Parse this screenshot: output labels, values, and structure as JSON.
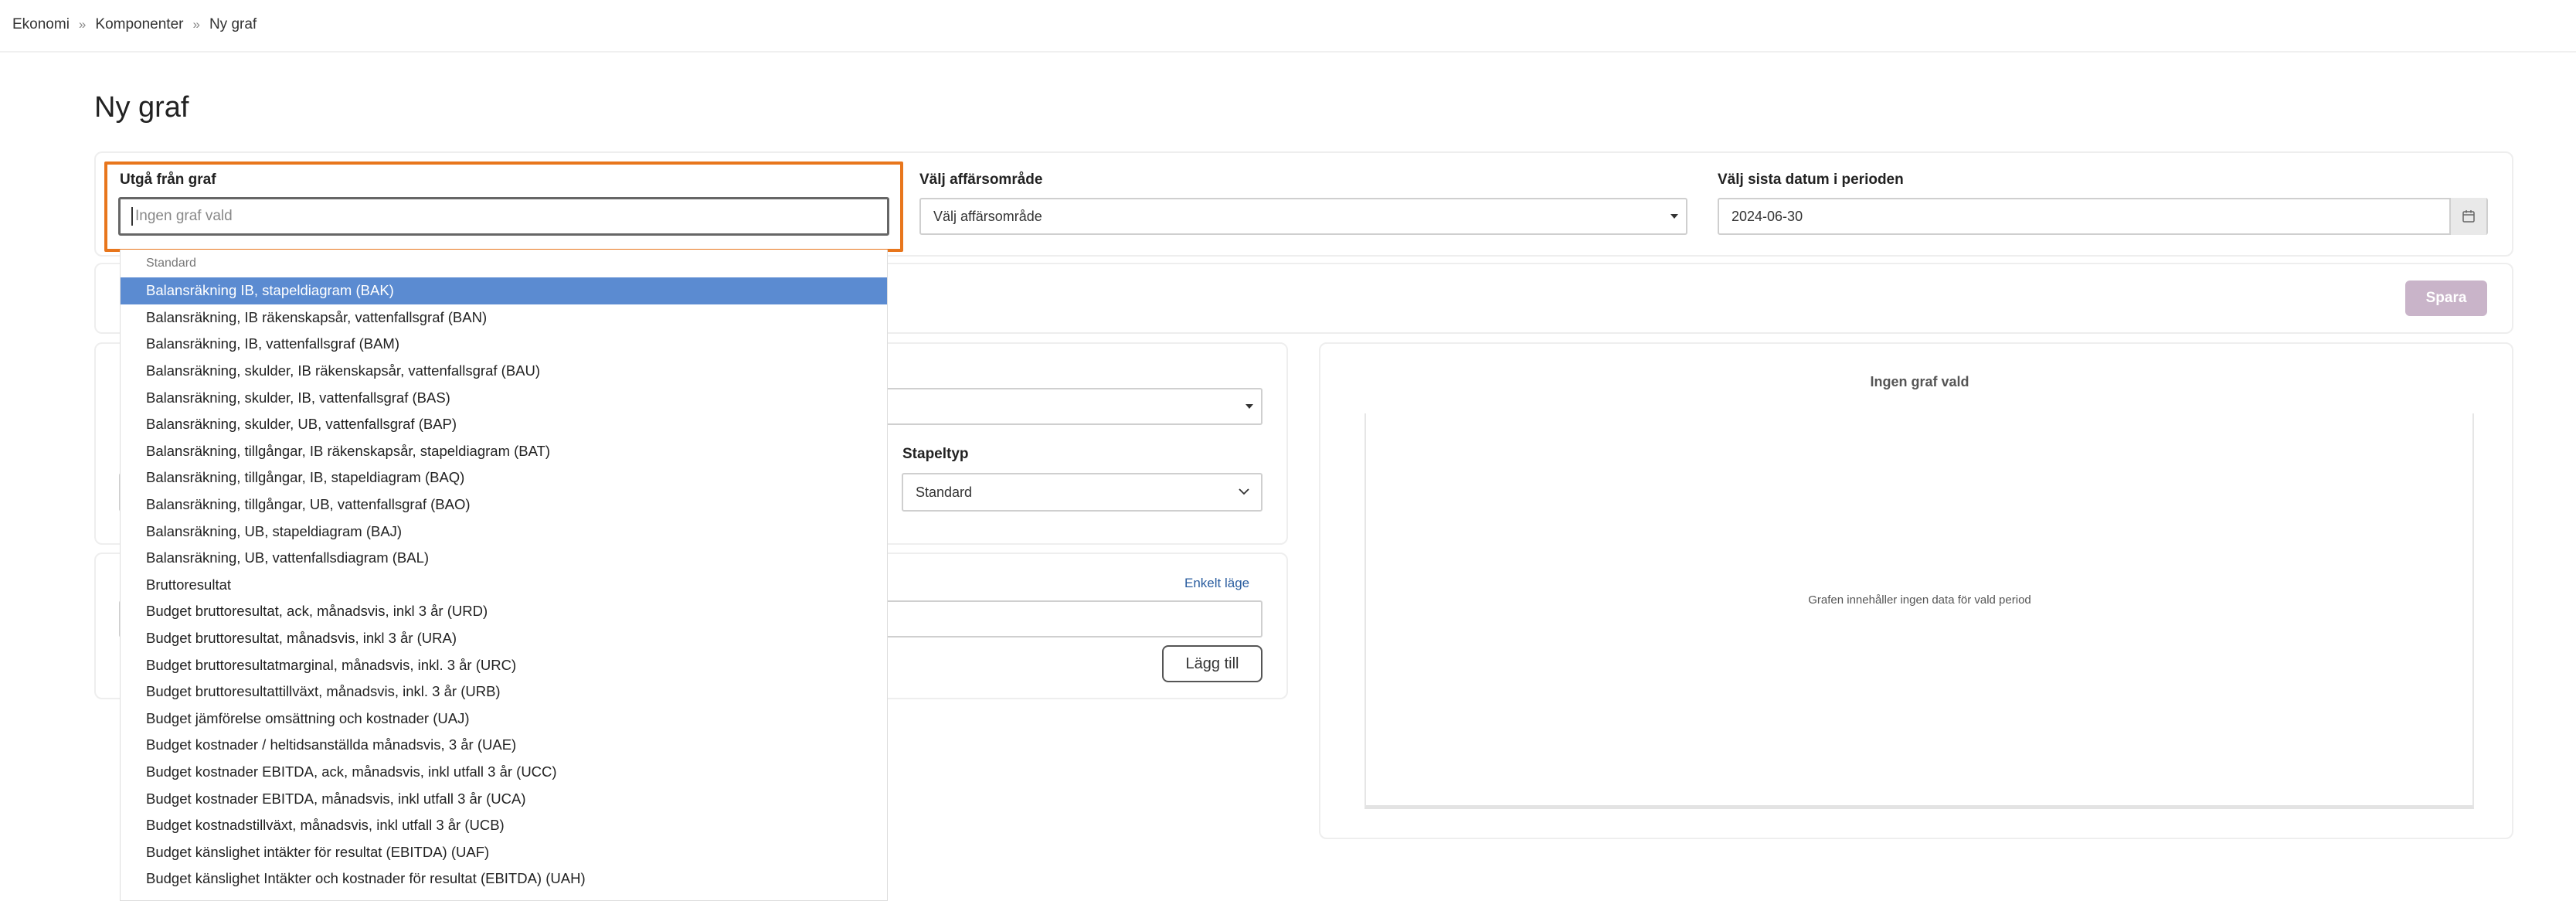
{
  "breadcrumb": {
    "items": [
      "Ekonomi",
      "Komponenter",
      "Ny graf"
    ],
    "separator": "»"
  },
  "page": {
    "title": "Ny graf"
  },
  "filters": {
    "base_graph": {
      "label": "Utgå från graf",
      "placeholder": "Ingen graf vald",
      "value": ""
    },
    "business_area": {
      "label": "Välj affärsområde",
      "value": "Välj affärsområde"
    },
    "end_date": {
      "label": "Välj sista datum i perioden",
      "value": "2024-06-30",
      "icon": "calendar-icon"
    }
  },
  "toolbar": {
    "save_label": "Spara"
  },
  "settings": {
    "bar_type": {
      "label": "Stapeltyp",
      "value": "Standard"
    },
    "single_mode_link": "Enkelt läge",
    "add_button": "Lägg till"
  },
  "preview": {
    "title": "Ingen graf vald",
    "empty_message": "Grafen innehåller ingen data för vald period"
  },
  "dropdown": {
    "group_label": "Standard",
    "selected_index": 0,
    "options": [
      "Balansräkning IB, stapeldiagram (BAK)",
      "Balansräkning, IB räkenskapsår, vattenfallsgraf (BAN)",
      "Balansräkning, IB, vattenfallsgraf (BAM)",
      "Balansräkning, skulder, IB räkenskapsår, vattenfallsgraf (BAU)",
      "Balansräkning, skulder, IB, vattenfallsgraf (BAS)",
      "Balansräkning, skulder, UB, vattenfallsgraf (BAP)",
      "Balansräkning, tillgångar, IB räkenskapsår, stapeldiagram (BAT)",
      "Balansräkning, tillgångar, IB, stapeldiagram (BAQ)",
      "Balansräkning, tillgångar, UB, vattenfallsgraf (BAO)",
      "Balansräkning, UB, stapeldiagram (BAJ)",
      "Balansräkning, UB, vattenfallsdiagram (BAL)",
      "Bruttoresultat",
      "Budget bruttoresultat, ack, månadsvis, inkl 3 år (URD)",
      "Budget bruttoresultat, månadsvis, inkl 3 år (URA)",
      "Budget bruttoresultatmarginal, månadsvis, inkl. 3 år (URC)",
      "Budget bruttoresultattillväxt, månadsvis, inkl. 3 år (URB)",
      "Budget jämförelse omsättning och kostnader (UAJ)",
      "Budget kostnader / heltidsanställda månadsvis, 3 år (UAE)",
      "Budget kostnader EBITDA, ack, månadsvis, inkl utfall 3 år (UCC)",
      "Budget kostnader EBITDA, månadsvis, inkl utfall 3 år (UCA)",
      "Budget kostnadstillväxt, månadsvis, inkl utfall 3 år (UCB)",
      "Budget känslighet intäkter för resultat (EBITDA) (UAF)",
      "Budget känslighet Intäkter och kostnader för resultat (EBITDA) (UAH)"
    ]
  }
}
